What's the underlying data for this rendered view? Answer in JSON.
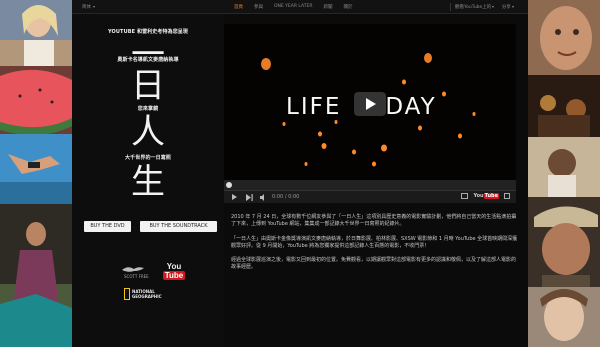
{
  "topnav": {
    "language": "简体",
    "items": [
      "首頁",
      "參與",
      "ONE YEAR LATER",
      "新聞",
      "關於"
    ],
    "active_index": 0,
    "share": "觀看YouTube上的",
    "extra": "分享"
  },
  "intro": {
    "line1": "YOUTUBE 和雷利史考特為您呈現",
    "line2": "奧斯卡名導凱文麥唐納執導",
    "line3": "您來掌鏡",
    "line4": "大千世界的一日寫照",
    "chars": [
      "一",
      "日",
      "人",
      "生"
    ]
  },
  "buttons": {
    "dvd": "BUY THE DVD",
    "soundtrack": "BUY THE SOUNDTRACK"
  },
  "logos": {
    "scott_free": "SCOTT FREE",
    "youtube_you": "You",
    "youtube_tube": "Tube",
    "ng_line1": "NATIONAL",
    "ng_line2": "GEOGRAPHIC"
  },
  "video": {
    "title_left": "LIFE",
    "title_right": "DAY",
    "time": "0:00 / 0:00",
    "progress": 0.0,
    "yt_you": "You",
    "yt_tube": "Tube"
  },
  "description": {
    "p1": "2010 年 7 月 24 日，全球有數千位網友參與了「一日人生」這項別具歷史意義的電影實驗計劃，他們將自己當天的生活點滴拍攝了下來，上傳到 YouTube 網站，集集成一部記錄大千世界一日寫照的紀錄片。",
    "p2": "「一日人生」由奧斯卡金像獎導演凱文麥唐納執導，於日舞影展、柏林影展、SXSW 電影節和 1 月時 YouTube 全球首映期間深獲觀眾好評。從 9 月開始，YouTube 將為您獨家提供這部記錄人生百態的電影，不收門票！",
    "p3": "經過全球影展巡演之後，電影又回到最初的位置。免費觀看，以期讓觀眾對這部電影有更多的認識和敬佩，以及了解這部人電影的故事經歷。"
  },
  "colors": {
    "accent": "#ff8a1f",
    "youtube_red": "#cc181e",
    "ng_yellow": "#f6c700"
  }
}
